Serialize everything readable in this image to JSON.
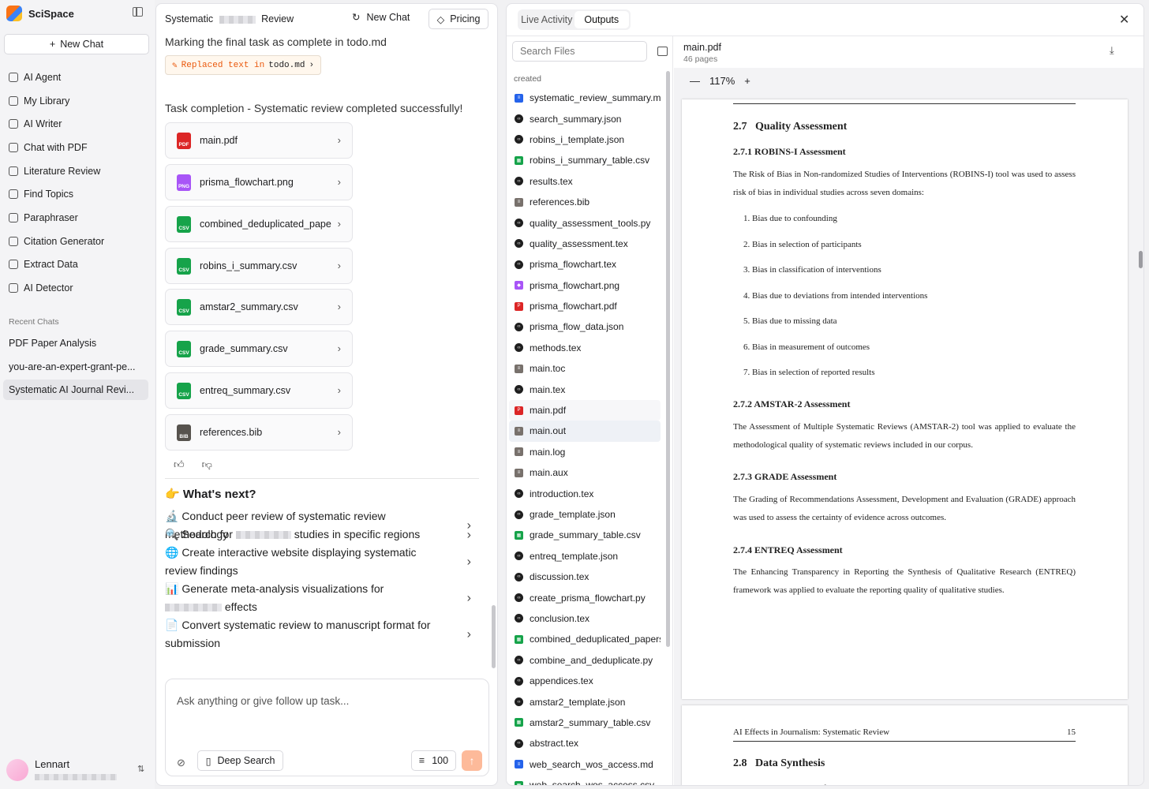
{
  "sidebar": {
    "brand": "SciSpace",
    "new_chat": "New Chat",
    "nav": [
      "AI Agent",
      "My Library",
      "AI Writer",
      "Chat with PDF",
      "Literature Review",
      "Find Topics",
      "Paraphraser",
      "Citation Generator",
      "Extract Data",
      "AI Detector"
    ],
    "recent_heading": "Recent Chats",
    "recent": [
      "PDF Paper Analysis",
      "you-are-an-expert-grant-pe...",
      "Systematic AI Journal Revi..."
    ],
    "user": "Lennart"
  },
  "chat": {
    "title_start": "Systematic",
    "title_end": "Review",
    "new_chat": "New Chat",
    "pricing": "Pricing",
    "marking": "Marking the final task as complete in todo.md",
    "chip_action": "Replaced text in",
    "chip_file": "todo.md",
    "completion": "Task completion - Systematic review completed successfully!",
    "files": [
      {
        "name": "main.pdf",
        "type": "PDF"
      },
      {
        "name": "prisma_flowchart.png",
        "type": "PNG"
      },
      {
        "name": "combined_deduplicated_pape",
        "type": "CSV"
      },
      {
        "name": "robins_i_summary.csv",
        "type": "CSV"
      },
      {
        "name": "amstar2_summary.csv",
        "type": "CSV"
      },
      {
        "name": "grade_summary.csv",
        "type": "CSV"
      },
      {
        "name": "entreq_summary.csv",
        "type": "CSV"
      },
      {
        "name": "references.bib",
        "type": "BIB"
      }
    ],
    "whats_next": "👉 What's next?",
    "suggestions": [
      "🔬 Conduct peer review of systematic review methodology",
      "🔍 Search for",
      "studies in specific regions",
      "🌐 Create interactive website displaying systematic review findings",
      "📊 Generate meta-analysis visualizations for",
      "effects",
      "📄 Convert systematic review to manuscript format for submission"
    ],
    "input_placeholder": "Ask anything or give follow up task...",
    "deep_search": "Deep Search",
    "credits": "100"
  },
  "outputs": {
    "tabs": [
      "Live Activity",
      "Outputs"
    ],
    "active_tab": "Outputs",
    "search_placeholder": "Search Files",
    "created_label": "created",
    "files": [
      {
        "name": "systematic_review_summary.md",
        "icon": "doc"
      },
      {
        "name": "search_summary.json",
        "icon": "code"
      },
      {
        "name": "robins_i_template.json",
        "icon": "code"
      },
      {
        "name": "robins_i_summary_table.csv",
        "icon": "csv"
      },
      {
        "name": "results.tex",
        "icon": "code"
      },
      {
        "name": "references.bib",
        "icon": "file"
      },
      {
        "name": "quality_assessment_tools.py",
        "icon": "code"
      },
      {
        "name": "quality_assessment.tex",
        "icon": "code"
      },
      {
        "name": "prisma_flowchart.tex",
        "icon": "code"
      },
      {
        "name": "prisma_flowchart.png",
        "icon": "image"
      },
      {
        "name": "prisma_flowchart.pdf",
        "icon": "pdf"
      },
      {
        "name": "prisma_flow_data.json",
        "icon": "code"
      },
      {
        "name": "methods.tex",
        "icon": "code"
      },
      {
        "name": "main.toc",
        "icon": "file"
      },
      {
        "name": "main.tex",
        "icon": "code"
      },
      {
        "name": "main.pdf",
        "icon": "pdf"
      },
      {
        "name": "main.out",
        "icon": "file"
      },
      {
        "name": "main.log",
        "icon": "file"
      },
      {
        "name": "main.aux",
        "icon": "file"
      },
      {
        "name": "introduction.tex",
        "icon": "code"
      },
      {
        "name": "grade_template.json",
        "icon": "code"
      },
      {
        "name": "grade_summary_table.csv",
        "icon": "csv"
      },
      {
        "name": "entreq_template.json",
        "icon": "code"
      },
      {
        "name": "discussion.tex",
        "icon": "code"
      },
      {
        "name": "create_prisma_flowchart.py",
        "icon": "code"
      },
      {
        "name": "conclusion.tex",
        "icon": "code"
      },
      {
        "name": "combined_deduplicated_papers.csv",
        "icon": "csv"
      },
      {
        "name": "combine_and_deduplicate.py",
        "icon": "code"
      },
      {
        "name": "appendices.tex",
        "icon": "code"
      },
      {
        "name": "amstar2_template.json",
        "icon": "code"
      },
      {
        "name": "amstar2_summary_table.csv",
        "icon": "csv"
      },
      {
        "name": "abstract.tex",
        "icon": "code"
      },
      {
        "name": "web_search_wos_access.md",
        "icon": "doc"
      },
      {
        "name": "web_search_wos_access.csv",
        "icon": "csv"
      }
    ],
    "viewer": {
      "file": "main.pdf",
      "pages": "46 pages",
      "zoom": "117%",
      "sec_num": "2.7",
      "sec_title": "Quality Assessment",
      "s1": "2.7.1   ROBINS-I Assessment",
      "p1": "The Risk of Bias in Non-randomized Studies of Interventions (ROBINS-I) tool was used to assess risk of bias in individual studies across seven domains:",
      "domains": [
        "1. Bias due to confounding",
        "2. Bias in selection of participants",
        "3. Bias in classification of interventions",
        "4. Bias due to deviations from intended interventions",
        "5. Bias due to missing data",
        "6. Bias in measurement of outcomes",
        "7. Bias in selection of reported results"
      ],
      "s2": "2.7.2   AMSTAR-2 Assessment",
      "p2": "The Assessment of Multiple Systematic Reviews (AMSTAR-2) tool was applied to evaluate the methodological quality of systematic reviews included in our corpus.",
      "s3": "2.7.3   GRADE Assessment",
      "p3": "The Grading of Recommendations Assessment, Development and Evaluation (GRADE) approach was used to assess the certainty of evidence across outcomes.",
      "s4": "2.7.4   ENTREQ Assessment",
      "p4": "The Enhancing Transparency in Reporting the Synthesis of Qualitative Research (ENTREQ) framework was applied to evaluate the reporting quality of qualitative studies.",
      "running_head": "AI Effects in Journalism: Systematic Review",
      "page_no": "15",
      "next_sec_num": "2.8",
      "next_sec_title": "Data Synthesis",
      "next_text": "Given the heterogeneity of study designs and outcomes, we conducted a narrative synthe-"
    }
  }
}
